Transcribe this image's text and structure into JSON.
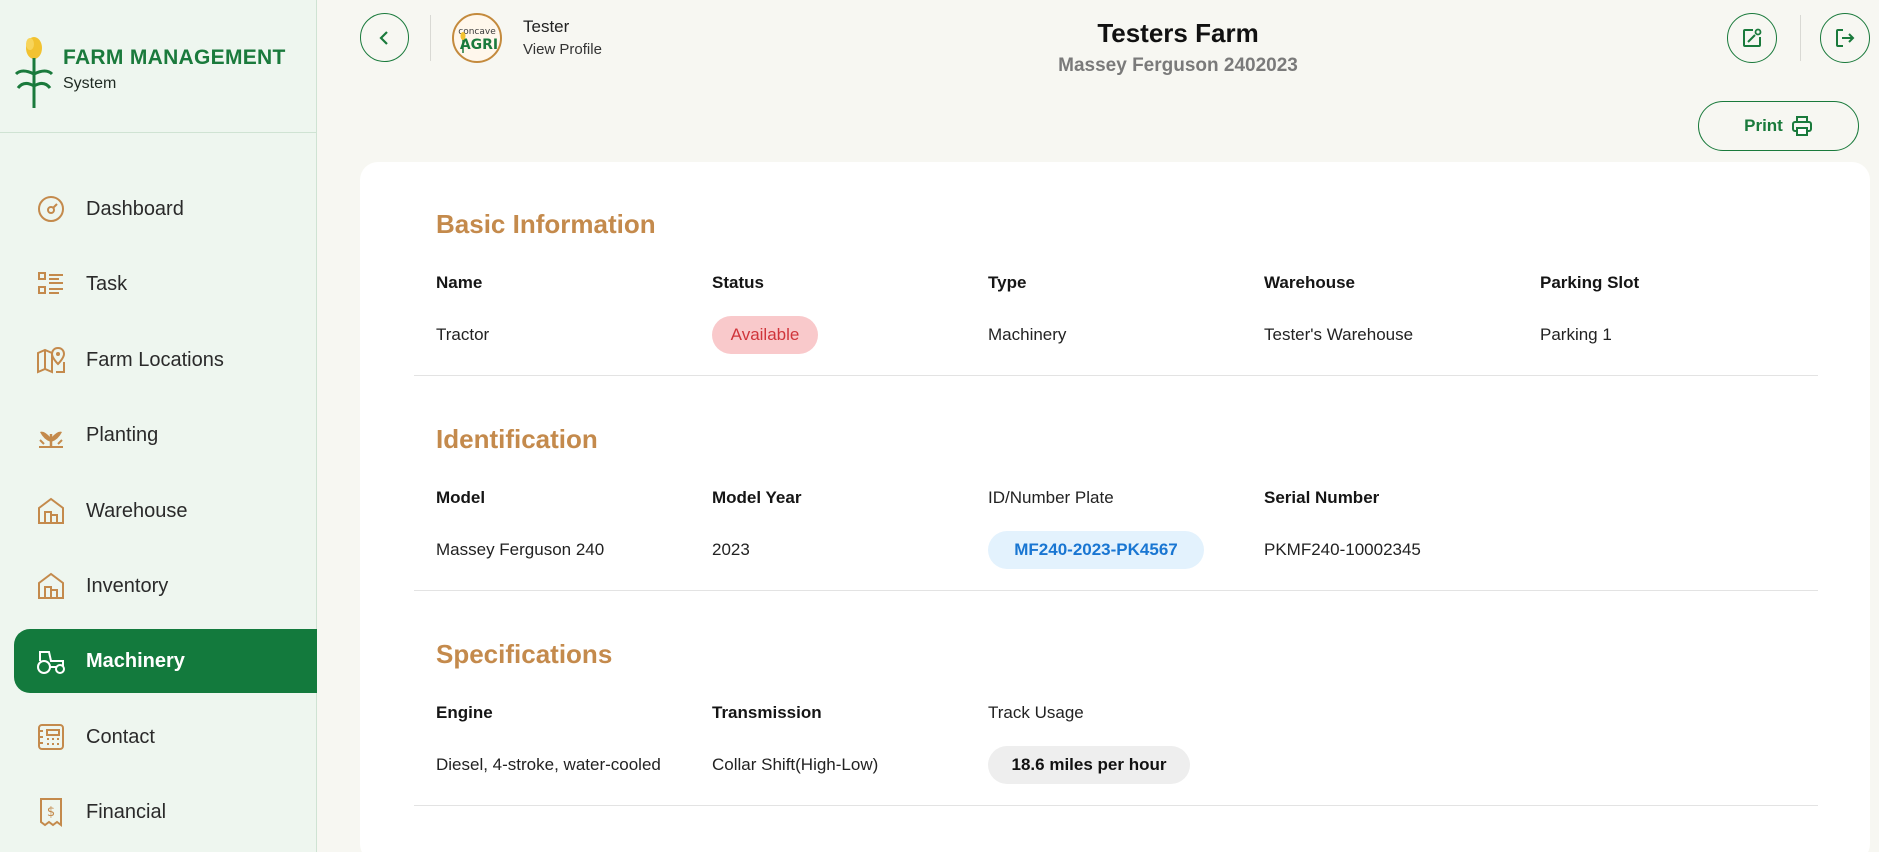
{
  "brand": {
    "title": "FARM MANAGEMENT",
    "subtitle": "System",
    "color": "#1a7a3c"
  },
  "sidebar": {
    "items": [
      {
        "label": "Dashboard",
        "icon": "gauge-icon",
        "active": false
      },
      {
        "label": "Task",
        "icon": "task-list-icon",
        "active": false
      },
      {
        "label": "Farm Locations",
        "icon": "map-pin-icon",
        "active": false
      },
      {
        "label": "Planting",
        "icon": "plant-icon",
        "active": false
      },
      {
        "label": "Warehouse",
        "icon": "warehouse-icon",
        "active": false
      },
      {
        "label": "Inventory",
        "icon": "inventory-icon",
        "active": false
      },
      {
        "label": "Machinery",
        "icon": "tractor-icon",
        "active": true
      },
      {
        "label": "Contact",
        "icon": "contact-icon",
        "active": false
      },
      {
        "label": "Financial",
        "icon": "receipt-icon",
        "active": false
      }
    ],
    "active_color": "#137a3d"
  },
  "header": {
    "profile_name": "Tester",
    "profile_link": "View Profile",
    "farm_title": "Testers Farm",
    "farm_subtitle": "Massey Ferguson 2402023",
    "print_label": "Print",
    "avatar_text": "CONCAVE AGRI"
  },
  "basic": {
    "title": "Basic Information",
    "headers": {
      "name": "Name",
      "status": "Status",
      "type": "Type",
      "warehouse": "Warehouse",
      "parking": "Parking Slot"
    },
    "values": {
      "name": "Tractor",
      "status": "Available",
      "type": "Machinery",
      "warehouse": "Tester's Warehouse",
      "parking": "Parking 1"
    }
  },
  "identification": {
    "title": "Identification",
    "headers": {
      "model": "Model",
      "model_year": "Model Year",
      "plate": "ID/Number Plate",
      "serial": "Serial Number"
    },
    "values": {
      "model": "Massey Ferguson 240",
      "model_year": "2023",
      "plate": "MF240-2023-PK4567",
      "serial": "PKMF240-10002345"
    }
  },
  "specifications": {
    "title": "Specifications",
    "headers": {
      "engine": "Engine",
      "transmission": "Transmission",
      "usage": "Track Usage"
    },
    "values": {
      "engine": "Diesel, 4-stroke, water-cooled",
      "transmission": "Collar Shift(High-Low)",
      "usage": "18.6 miles per hour"
    }
  },
  "colors": {
    "accent": "#1a7a3c",
    "section_title": "#c48a4c",
    "status_bg": "#f9c9cb",
    "status_text": "#d0353b",
    "plate_bg": "#e3f2fd",
    "plate_text": "#1976d2"
  }
}
